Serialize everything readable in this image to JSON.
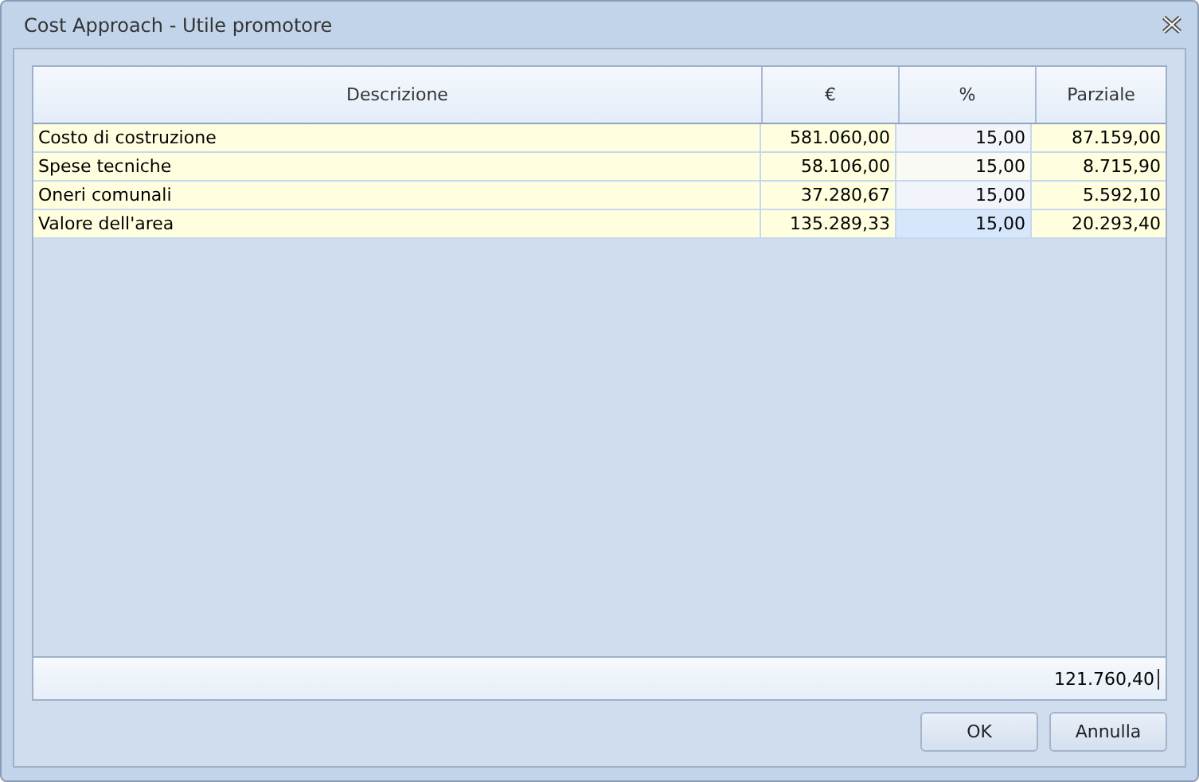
{
  "window": {
    "title": "Cost Approach - Utile promotore"
  },
  "table": {
    "columns": [
      "Descrizione",
      "€",
      "%",
      "Parziale"
    ],
    "rows": [
      {
        "descrizione": "Costo di costruzione",
        "euro": "581.060,00",
        "percent": "15,00",
        "parziale": "87.159,00",
        "selected": false
      },
      {
        "descrizione": "Spese tecniche",
        "euro": "58.106,00",
        "percent": "15,00",
        "parziale": "8.715,90",
        "selected": false
      },
      {
        "descrizione": "Oneri comunali",
        "euro": "37.280,67",
        "percent": "15,00",
        "parziale": "5.592,10",
        "selected": false
      },
      {
        "descrizione": "Valore dell'area",
        "euro": "135.289,33",
        "percent": "15,00",
        "parziale": "20.293,40",
        "selected": true
      }
    ],
    "total": "121.760,40"
  },
  "buttons": [
    "OK",
    "Annulla"
  ]
}
